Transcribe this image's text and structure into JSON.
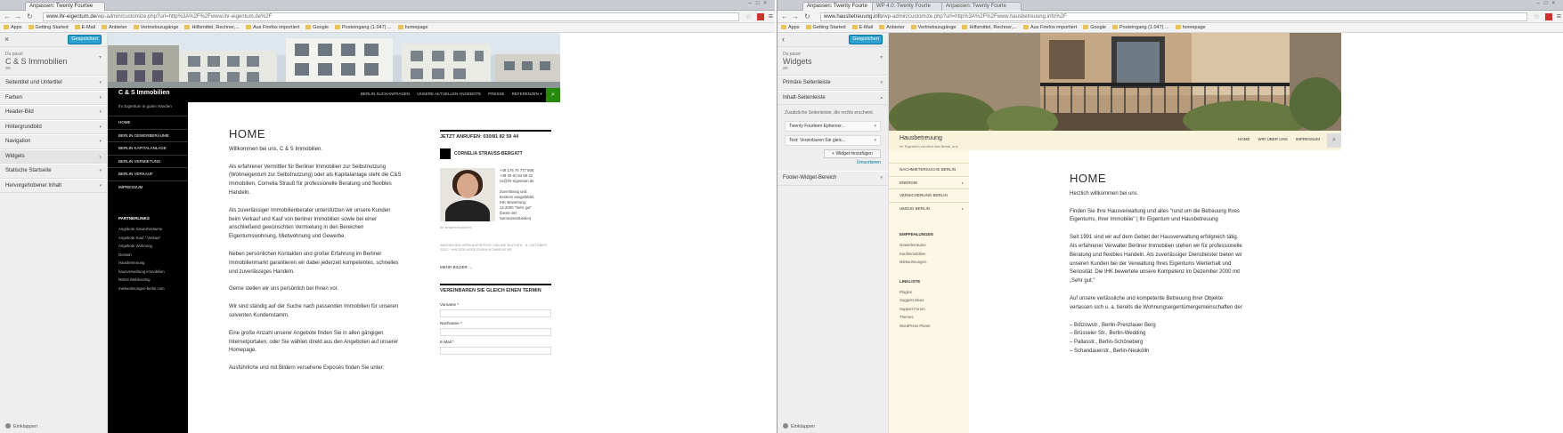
{
  "left": {
    "tab": "Anpassen: Twenty Fourtee",
    "url_prefix": "www.ihr-eigentum.de",
    "url_rest": "/wp-admin/customize.php?url=http%3A%2F%2Fwww.ihr-eigentum.de%2F",
    "bookmarks": [
      "Apps",
      "Getting Started",
      "E-Mail",
      "Anbieter",
      "Vertriebszugänge",
      "Hilfsmittel, Rechner,...",
      "Aus Firefox importiert",
      "Google",
      "Posteingang (1.047) ...",
      "homepage"
    ],
    "panel": {
      "close": "×",
      "button": "Gespeichert",
      "sm1": "Du passt",
      "title": "C & S Immobilien",
      "sm2": "an.",
      "sections": [
        "Seitentitel und Untertitel",
        "Farben",
        "Header-Bild",
        "Hintergrundbild",
        "Navigation",
        "Widgets",
        "Statische Startseite",
        "Hervorgehobener Inhalt"
      ],
      "collapse": "Einklappen"
    },
    "site": {
      "title": "C & S Immobilien",
      "tagline": "Ihr Eigentum in guten Händen",
      "menu": [
        "BERLIN SUCHANFRAGEN",
        "UNSERE AKTUELLEN ANGEBOTE",
        "PRESSE",
        "REFERENZEN ▾"
      ],
      "nav": [
        "HOME",
        "BERLIN GEWERBERÄUME",
        "BERLIN KAPITALANLAGE",
        "BERLIN VERMIETUNG",
        "BERLIN VERKAUF",
        "IMPRESSUM"
      ],
      "group_title": "PARTNERLINKS",
      "group_links": [
        "Angebote Gewerberäume",
        "Angebote Kauf / Verkauf",
        "Angebote Wohnung",
        "Domain",
        "Hausbetreuung",
        "hausverwaltung immobilien",
        "MrDot Webhosting",
        "mietwohnungen-berlin.com"
      ],
      "h1": "HOME",
      "paras": [
        "Willkommen bei uns, C & S Immobilien.",
        "Als erfahrener Vermittler für Berliner Immobilien zur Selbstnutzung (Wohneigentum zur Selbstnutzung) oder als Kapitalanlage steht die C&S Immobilien, Cornelia Strauß für professionelle Beratung und flexibles Handeln.",
        "Als zuverlässiger Immobilienberater unterstützen wir unsere Kunden beim Verkauf und Kauf von berliner Immobilien sowie bei einer anschließend gewünschten Vermietung in den Bereichen Eigentumswohnung, Mietwohnung und Gewerbe.",
        "Neben persönlichen Kontakten und großer Erfahrung im Berliner Immobilienmarkt garantieren wir dabei jederzeit kompetentes, schnelles und zuverlässiges Handeln.",
        "Gerne stellen wir uns persönlich bei Ihnen vor.",
        "Wir sind ständig auf der Suche nach passenden Immobilien für unseren solventen Kundenstamm.",
        "Eine große Anzahl unserer Angebote finden Sie in allen gängigen Internetportalen, oder Sie wählen direkt aus den Angeboten auf unserer Homepage.",
        "Ausführliche und mit Bildern versehene Exposés finden Sie unter:"
      ],
      "r_call": "JETZT ANRUFEN: 030/81 82 59 44",
      "r_name": "CORNELIA STRAUSS-BERGATT",
      "r_info": [
        "+49 176 76 777 806",
        "+49 30 81 82 59 42",
        "cs@ihr-eigentum.de",
        "",
        "Zuverlässig und",
        "bestens ausgebildet,",
        "IHK Bewertung:",
        "12.2000 \"Sehr gut\"",
        "(beste der",
        "Semesterarbeiten)"
      ],
      "r_caption": "Ihr Ansprechpartner",
      "r_meta": "IMMOBILIEN VERKAUFSPROFI ONLINE BUCHEN · 8. OKTOBER 2012 · HINTERLASSE EINEN KOMMENTAR",
      "r_more": "MEHR BILDER →",
      "r_form_title": "VEREINBAREN SIE GLEICH EINEN TERMIN",
      "r_fields": [
        "Vorname *",
        "Nachname *",
        "E-Mail *"
      ]
    }
  },
  "right": {
    "tabs": [
      "Anpassen: Twenty Fourte",
      "WP 4.0: Twenty Fourte",
      "Anpassen: Twenty Fourte"
    ],
    "url_prefix": "www.hausbetreuung.info",
    "url_rest": "/wp-admin/customize.php?url=http%3A%2F%2Fwww.hausbetreuung.info%2F",
    "bookmarks": [
      "Apps",
      "Getting Started",
      "E-Mail",
      "Anbieter",
      "Vertriebszugänge",
      "Hilfsmittel, Rechner,...",
      "Aus Firefox importiert",
      "Google",
      "Posteingang (1.047) ...",
      "homepage"
    ],
    "panel": {
      "back": "‹",
      "button": "Gespeichert",
      "sm1": "Du passt",
      "title": "Widgets",
      "sm2": "an.",
      "sections": [
        "Primäre Seitenleiste",
        "Inhalt-Seitenleiste"
      ],
      "desc": "Zusätzliche Seitenleiste, die rechts erscheint.",
      "widgets": [
        "Twenty Fourteen Ephemer...",
        "Text: Vereinbaren Sie gleic..."
      ],
      "add": "Widget hinzufügen",
      "reorder": "Umsortieren",
      "footer_section": "Footer-Widget-Bereich",
      "collapse": "Einklappen"
    },
    "site": {
      "title": "Hausbetreuung",
      "tagline": "Ihr Eigentum verdient das Beste, uns",
      "menu": [
        "HOME",
        "WIR ÜBER UNS",
        "IMPRESSUM"
      ],
      "nav": [
        "NACHMIETERSUCHE BERLIN",
        "ENERGIE",
        "VERSICHERUNG BERLIN",
        "UMZUG BERLIN"
      ],
      "groups": [
        {
          "title": "EMPFEHLUNGEN",
          "links": [
            "Gewerberäume",
            "Kaufimmobilien",
            "Mietwohnungen"
          ]
        },
        {
          "title": "LINKLISTE",
          "links": [
            "Plugins",
            "Suggest Ideas",
            "Support Forum",
            "Themes",
            "WordPress Planet"
          ]
        }
      ],
      "h1": "HOME",
      "paras": [
        "Herzlich willkommen bei uns",
        "Finden Sie Ihre Hausverwaltung und alles \"rund um die Betreuung Ihres Eigentums, Ihrer Immobilie\" | Ihr Eigentum und Hausbetreuung",
        "Seit 1991 sind wir auf dem Gebiet der Hausverwaltung erfolgreich tätig. Als erfahrener Verwalter Berliner Immobilien stehen wir für professionelle Beratung und flexibles Handeln. Als zuverlässiger Dienstleister bieten wir unseren Kunden bei der Verwaltung Ihres Eigentums Werterhalt und Seriosität. Die IHK bewertete unsere Kompetenz im Dezember 2000 mit „Sehr gut.\"",
        "Auf unsere verlässliche und kompetente Betreuung ihrer Objekte verlassen sich u. a. bereits die Wohnungseigentümergemeinschaften der"
      ],
      "list": [
        "– Bötzowstr., Berlin-Prenzlauer Berg",
        "– Brüsseler Str., Berlin-Wedding",
        "– Pallasstr., Berlin-Schöneberg",
        "– Schandauerstr., Berlin-Neukölln"
      ]
    }
  }
}
